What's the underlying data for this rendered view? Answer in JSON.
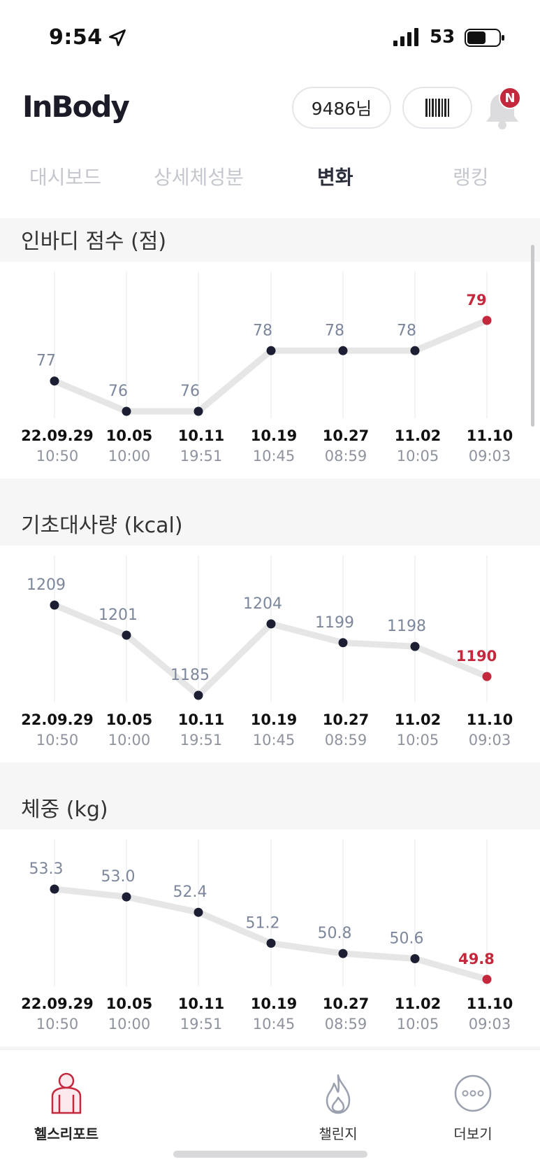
{
  "status": {
    "time": "9:54",
    "battery": "53"
  },
  "header": {
    "logo": "InBody",
    "user": "9486님"
  },
  "tabs": [
    {
      "label": "대시보드",
      "active": false
    },
    {
      "label": "상세체성분",
      "active": false
    },
    {
      "label": "변화",
      "active": true
    },
    {
      "label": "랭킹",
      "active": false
    }
  ],
  "charts": [
    {
      "title": "인바디 점수 (점)"
    },
    {
      "title": "기초대사량 (kcal)"
    },
    {
      "title": "체중 (kg)"
    }
  ],
  "nav": [
    {
      "label": "헬스리포트",
      "icon": "health-report-icon",
      "active": true
    },
    {
      "label": "챌린지",
      "icon": "flame-icon",
      "active": false
    },
    {
      "label": "더보기",
      "icon": "more-icon",
      "active": false
    }
  ],
  "colors": {
    "accent": "#c4283c",
    "point": "#1c1f33",
    "line": "#e6e6e6",
    "label": "#7d879b"
  },
  "chart_data": [
    {
      "type": "line",
      "title": "인바디 점수 (점)",
      "x": [
        "22.09.29",
        "10.05",
        "10.11",
        "10.19",
        "10.27",
        "11.02",
        "11.10"
      ],
      "times": [
        "10:50",
        "10:00",
        "19:51",
        "10:45",
        "08:59",
        "10:05",
        "09:03"
      ],
      "values": [
        77,
        76,
        76,
        78,
        78,
        78,
        79
      ],
      "labels": [
        "77",
        "76",
        "76",
        "78",
        "78",
        "78",
        "79"
      ],
      "ylim": [
        76,
        79
      ],
      "grid": true
    },
    {
      "type": "line",
      "title": "기초대사량 (kcal)",
      "x": [
        "22.09.29",
        "10.05",
        "10.11",
        "10.19",
        "10.27",
        "11.02",
        "11.10"
      ],
      "times": [
        "10:50",
        "10:00",
        "19:51",
        "10:45",
        "08:59",
        "10:05",
        "09:03"
      ],
      "values": [
        1209,
        1201,
        1185,
        1204,
        1199,
        1198,
        1190
      ],
      "labels": [
        "1209",
        "1201",
        "1185",
        "1204",
        "1199",
        "1198",
        "1190"
      ],
      "ylim": [
        1185,
        1209
      ],
      "grid": true
    },
    {
      "type": "line",
      "title": "체중 (kg)",
      "x": [
        "22.09.29",
        "10.05",
        "10.11",
        "10.19",
        "10.27",
        "11.02",
        "11.10"
      ],
      "times": [
        "10:50",
        "10:00",
        "19:51",
        "10:45",
        "08:59",
        "10:05",
        "09:03"
      ],
      "values": [
        53.3,
        53.0,
        52.4,
        51.2,
        50.8,
        50.6,
        49.8
      ],
      "labels": [
        "53.3",
        "53.0",
        "52.4",
        "51.2",
        "50.8",
        "50.6",
        "49.8"
      ],
      "ylim": [
        49.8,
        53.3
      ],
      "grid": true
    }
  ]
}
